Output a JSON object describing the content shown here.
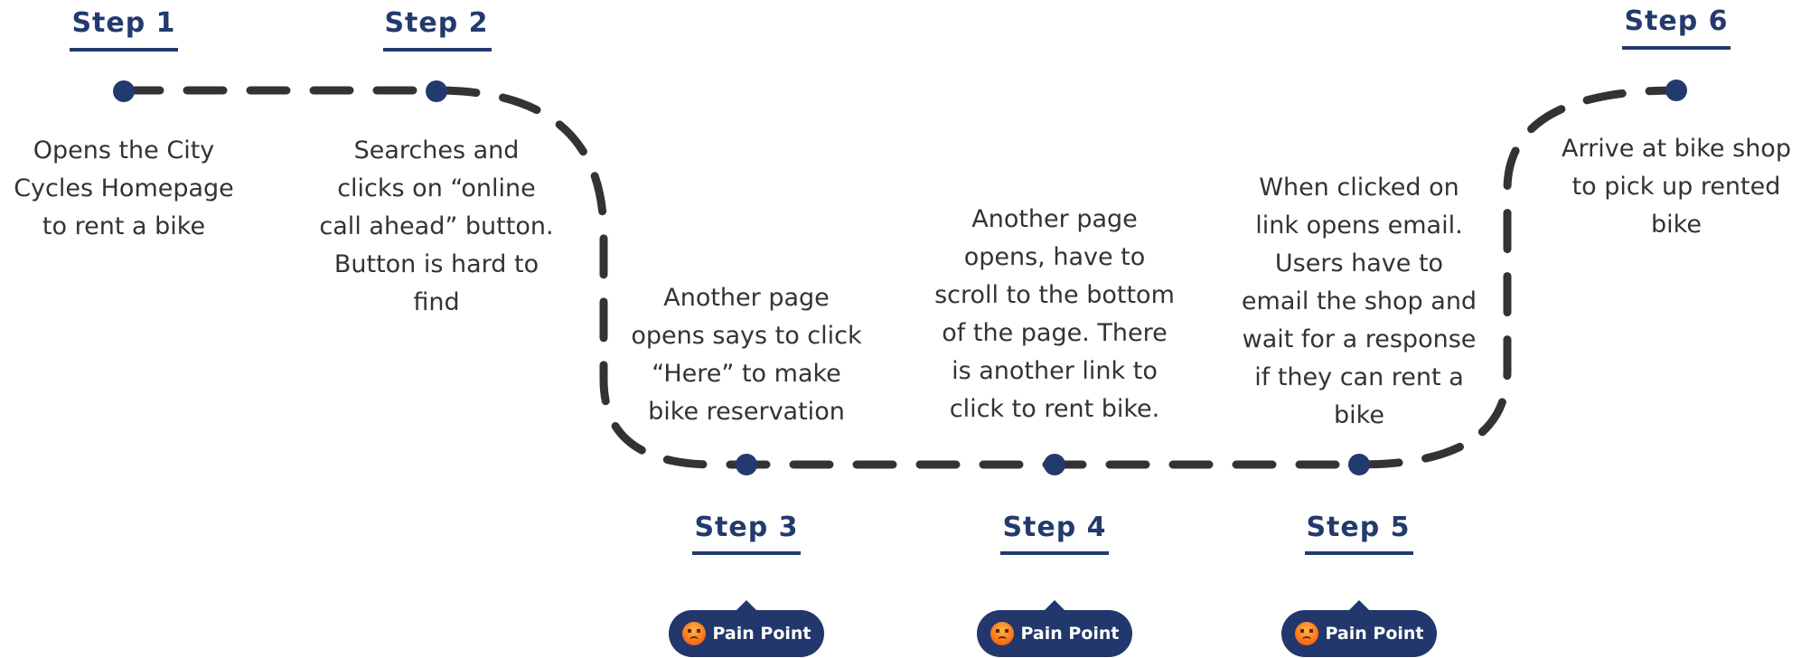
{
  "colors": {
    "accent": "#233a6e",
    "path": "#333333",
    "text": "#333333",
    "pill": "#22376b"
  },
  "steps": [
    {
      "label": "Step 1",
      "lines": [
        "Opens the City",
        "Cycles Homepage",
        "to rent a bike"
      ],
      "pain_point": null
    },
    {
      "label": "Step 2",
      "lines": [
        "Searches and",
        "clicks on “online",
        "call ahead” button.",
        "Button is hard to",
        "find"
      ],
      "pain_point": null
    },
    {
      "label": "Step 3",
      "lines": [
        "Another page",
        "opens says to click",
        "“Here” to make",
        "bike reservation"
      ],
      "pain_point": {
        "icon": "angry-face-icon",
        "label": "Pain Point"
      }
    },
    {
      "label": "Step 4",
      "lines": [
        "Another page",
        "opens, have to",
        "scroll to the bottom",
        "of the page. There",
        "is another link to",
        "click to rent bike."
      ],
      "pain_point": {
        "icon": "angry-face-icon",
        "label": "Pain Point"
      }
    },
    {
      "label": "Step 5",
      "lines": [
        "When clicked on",
        "link opens email.",
        "Users have to",
        "email the shop and",
        "wait for a response",
        "if they can rent a",
        "bike"
      ],
      "pain_point": {
        "icon": "angry-face-icon",
        "label": "Pain Point"
      }
    },
    {
      "label": "Step 6",
      "lines": [
        "Arrive at bike shop",
        "to pick up rented",
        "bike"
      ],
      "pain_point": null
    }
  ]
}
